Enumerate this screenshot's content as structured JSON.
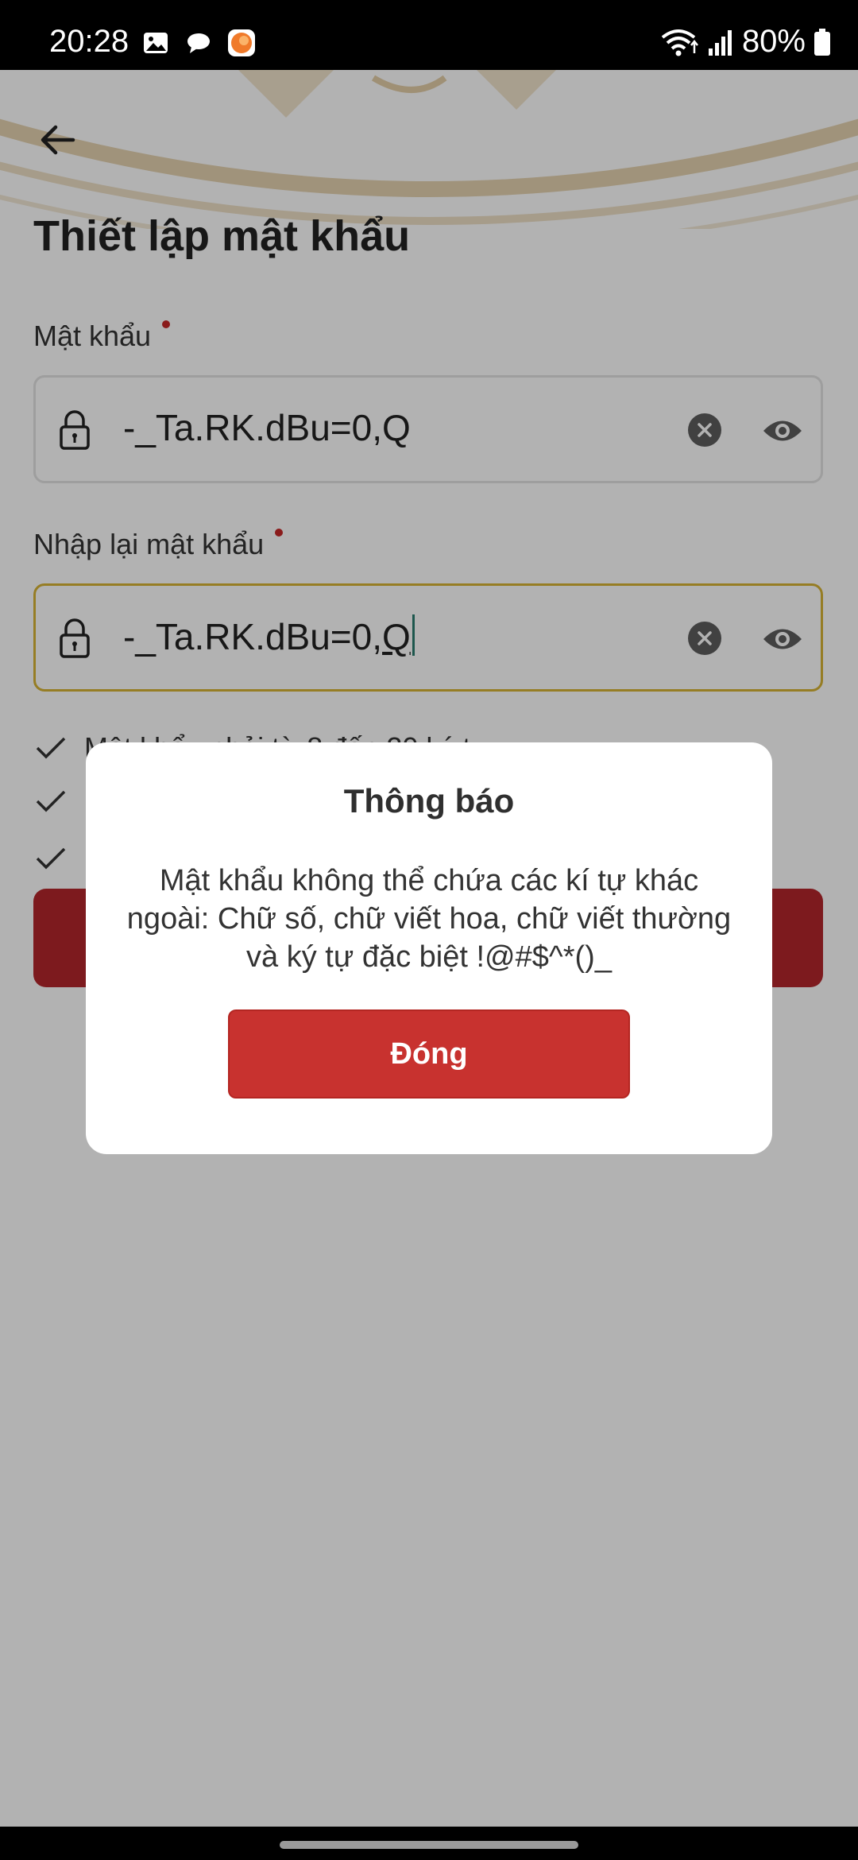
{
  "status_bar": {
    "time": "20:28",
    "battery": "80%",
    "notification_icons": [
      "image-icon",
      "chat-bubble-icon",
      "app-orange-icon"
    ],
    "system_icons": [
      "wifi-icon",
      "signal-icon",
      "battery-icon"
    ]
  },
  "header": {
    "back_icon": "arrow-left-icon",
    "title": "Thiết lập mật khẩu"
  },
  "form": {
    "password": {
      "label": "Mật khẩu",
      "value": "-_Ta.RK.dBu=0,Q",
      "required": true
    },
    "confirm_password": {
      "label": "Nhập lại mật khẩu",
      "value_prefix": "-_Ta.RK.dBu=0,",
      "value_last": "Q",
      "required": true,
      "focused": true
    },
    "rules": [
      {
        "text": "Mật khẩu phải từ 8 đến 20 ký tự",
        "checked": true
      }
    ]
  },
  "dialog": {
    "title": "Thông báo",
    "message": "Mật khẩu không thể chứa các kí tự khác ngoài: Chữ số, chữ viết hoa, chữ viết thường và ký tự đặc biệt !@#$^*()_",
    "button_label": "Đóng"
  },
  "colors": {
    "primary": "#c8322f",
    "focus_border": "#d7b334",
    "required_dot": "#c62828"
  }
}
